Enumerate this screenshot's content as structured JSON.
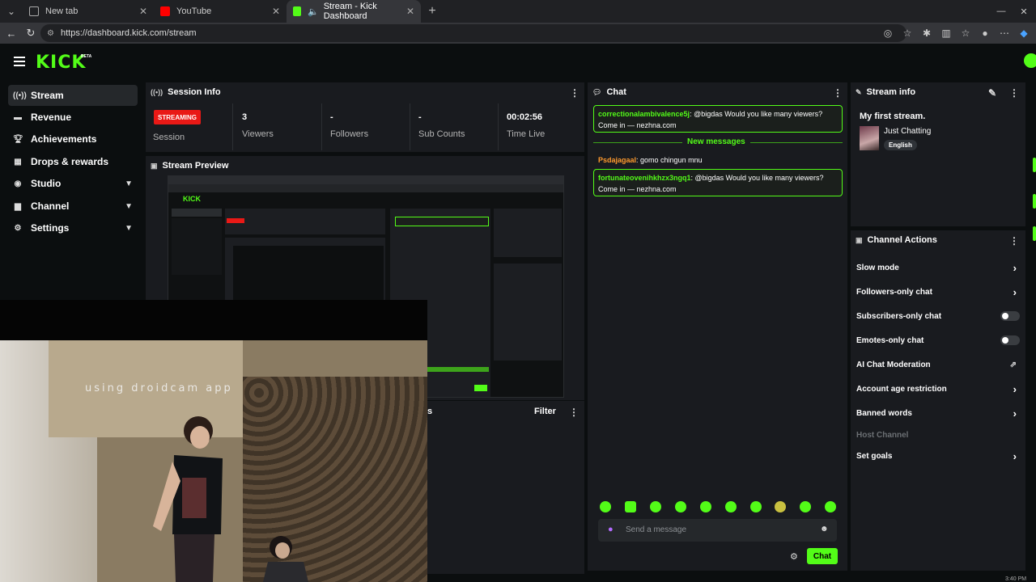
{
  "browser": {
    "tabs": [
      {
        "label": "New tab"
      },
      {
        "label": "YouTube"
      },
      {
        "label": "Stream - Kick Dashboard"
      }
    ],
    "url": "https://dashboard.kick.com/stream"
  },
  "brand": {
    "logo": "KICK",
    "beta": "BETA",
    "accent": "#53fc18"
  },
  "sidebar": {
    "items": [
      {
        "label": "Stream",
        "icon": "broadcast-icon"
      },
      {
        "label": "Revenue",
        "icon": "money-icon"
      },
      {
        "label": "Achievements",
        "icon": "trophy-icon"
      },
      {
        "label": "Drops & rewards",
        "icon": "gift-icon"
      },
      {
        "label": "Studio",
        "icon": "camera-icon"
      },
      {
        "label": "Channel",
        "icon": "channel-icon"
      },
      {
        "label": "Settings",
        "icon": "gear-icon"
      }
    ]
  },
  "session": {
    "title": "Session Info",
    "status": "STREAMING",
    "status_label": "Session",
    "stats": [
      {
        "value": "3",
        "label": "Viewers"
      },
      {
        "value": "-",
        "label": "Followers"
      },
      {
        "value": "-",
        "label": "Sub Counts"
      },
      {
        "value": "00:02:56",
        "label": "Time Live"
      }
    ]
  },
  "preview": {
    "title": "Stream Preview"
  },
  "webcam": {
    "overlay_text": "using droidcam app"
  },
  "lower_panel": {
    "title_fragment": "s",
    "filter_label": "Filter"
  },
  "chat": {
    "title": "Chat",
    "new_messages": "New messages",
    "messages": [
      {
        "user": "correctionalambivalence5j",
        "text": ": @bigdas Would you like many viewers? Come in — nezhna.com",
        "highlight": true
      },
      {
        "user": "Psdajagaal",
        "text": ": gomo chingun mnu",
        "highlight": false
      },
      {
        "user": "fortunateovenihkhzx3ngq1",
        "text": ": @bigdas Would you like many viewers? Come in — nezhna.com",
        "highlight": true
      }
    ],
    "input_placeholder": "Send a message",
    "send_label": "Chat"
  },
  "stream_info": {
    "title": "Stream info",
    "stream_title": "My first stream.",
    "category": "Just Chatting",
    "language": "English"
  },
  "channel_actions": {
    "title": "Channel Actions",
    "items": [
      {
        "label": "Slow mode",
        "control": "chevron"
      },
      {
        "label": "Followers-only chat",
        "control": "chevron"
      },
      {
        "label": "Subscribers-only chat",
        "control": "toggle"
      },
      {
        "label": "Emotes-only chat",
        "control": "toggle"
      },
      {
        "label": "AI Chat Moderation",
        "control": "external"
      },
      {
        "label": "Account age restriction",
        "control": "chevron"
      },
      {
        "label": "Banned words",
        "control": "chevron"
      },
      {
        "label": "Host Channel",
        "control": "disabled"
      },
      {
        "label": "Set goals",
        "control": "chevron"
      }
    ]
  },
  "clock": {
    "time": "3:40 PM"
  }
}
